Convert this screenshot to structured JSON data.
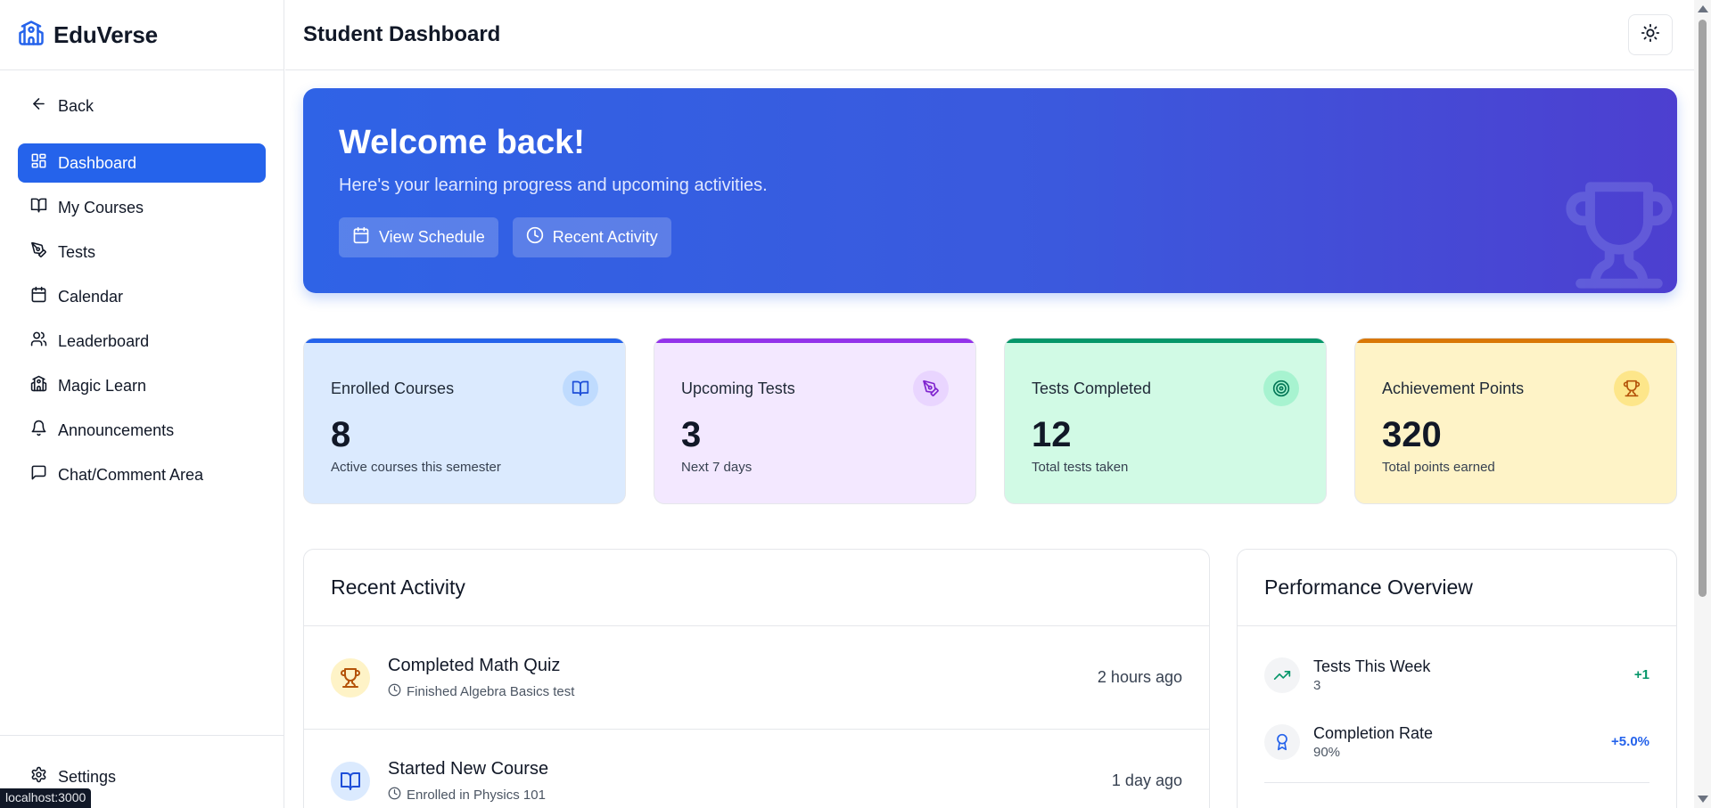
{
  "brand": {
    "name": "EduVerse",
    "icon": "school-icon"
  },
  "header": {
    "title": "Student Dashboard",
    "theme_icon": "sun-icon"
  },
  "sidebar": {
    "back_label": "Back",
    "items": [
      {
        "label": "Dashboard",
        "icon": "dashboard-icon",
        "active": true
      },
      {
        "label": "My Courses",
        "icon": "book-open-icon"
      },
      {
        "label": "Tests",
        "icon": "pen-tool-icon"
      },
      {
        "label": "Calendar",
        "icon": "calendar-icon"
      },
      {
        "label": "Leaderboard",
        "icon": "users-icon"
      },
      {
        "label": "Magic Learn",
        "icon": "school-icon"
      },
      {
        "label": "Announcements",
        "icon": "bell-icon"
      },
      {
        "label": "Chat/Comment Area",
        "icon": "message-square-icon"
      }
    ],
    "settings_label": "Settings"
  },
  "status_url": "localhost:3000",
  "hero": {
    "title": "Welcome back!",
    "subtitle": "Here's your learning progress and upcoming activities.",
    "view_schedule": "View Schedule",
    "recent_activity": "Recent Activity",
    "gradient": [
      "#2f63e6",
      "#4d3fd0"
    ]
  },
  "stats": [
    {
      "label": "Enrolled Courses",
      "value": "8",
      "note": "Active courses this semester",
      "icon": "book-open-icon",
      "bg": "#dbeafe",
      "accent": "#2563eb"
    },
    {
      "label": "Upcoming Tests",
      "value": "3",
      "note": "Next 7 days",
      "icon": "pen-tool-icon",
      "bg": "#f3e8ff",
      "accent": "#9333ea"
    },
    {
      "label": "Tests Completed",
      "value": "12",
      "note": "Total tests taken",
      "icon": "target-icon",
      "bg": "#d1fae5",
      "accent": "#059669"
    },
    {
      "label": "Achievement Points",
      "value": "320",
      "note": "Total points earned",
      "icon": "trophy-icon",
      "bg": "#fef3c7",
      "accent": "#d97706"
    }
  ],
  "recent_activity": {
    "title": "Recent Activity",
    "items": [
      {
        "title": "Completed Math Quiz",
        "desc": "Finished Algebra Basics test",
        "time": "2 hours ago",
        "icon": "trophy-icon"
      },
      {
        "title": "Started New Course",
        "desc": "Enrolled in Physics 101",
        "time": "1 day ago",
        "icon": "book-open-icon"
      }
    ]
  },
  "performance": {
    "title": "Performance Overview",
    "items": [
      {
        "label": "Tests This Week",
        "value": "3",
        "delta": "+1",
        "icon": "trending-up-icon",
        "color": "#059669"
      },
      {
        "label": "Completion Rate",
        "value": "90%",
        "delta": "+5.0%",
        "icon": "award-icon",
        "color": "#2563eb"
      }
    ]
  }
}
